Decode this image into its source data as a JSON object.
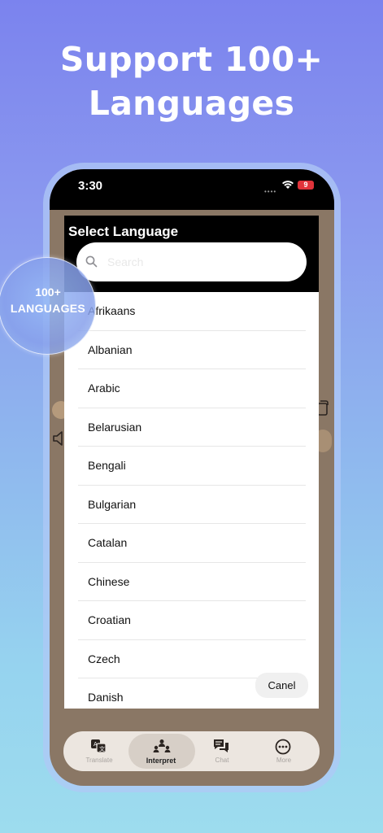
{
  "headline": {
    "line1": "Support 100+",
    "line2": "Languages"
  },
  "status_bar": {
    "time": "3:30",
    "battery": "9"
  },
  "badge": {
    "count": "100+",
    "label": "LANGUAGES"
  },
  "modal": {
    "title": "Select Language",
    "search": {
      "placeholder": "Search",
      "value": ""
    },
    "languages": [
      "Afrikaans",
      "Albanian",
      "Arabic",
      "Belarusian",
      "Bengali",
      "Bulgarian",
      "Catalan",
      "Chinese",
      "Croatian",
      "Czech",
      "Danish"
    ],
    "cancel_label": "Canel"
  },
  "tab_bar": {
    "tabs": [
      {
        "label": "Translate",
        "icon": "translate-icon"
      },
      {
        "label": "Interpret",
        "icon": "interpret-icon"
      },
      {
        "label": "Chat",
        "icon": "chat-icon"
      },
      {
        "label": "More",
        "icon": "more-icon"
      }
    ],
    "active": "Interpret"
  },
  "colors": {
    "gradient_top": "#7b83ee",
    "gradient_bottom": "#9ddcee",
    "battery": "#e0333a",
    "app_background": "#8a7765"
  }
}
